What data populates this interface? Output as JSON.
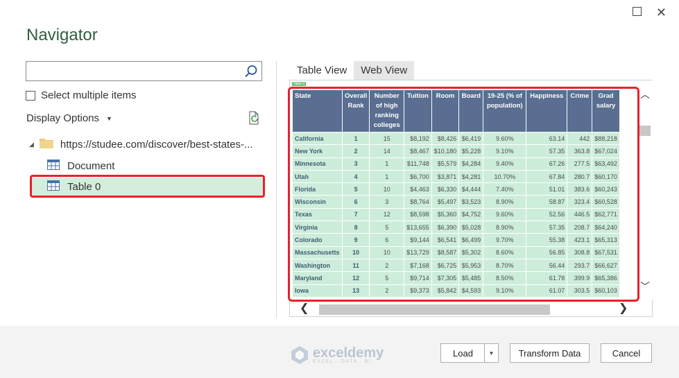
{
  "window": {
    "title": "Navigator"
  },
  "search": {
    "value": "",
    "placeholder": ""
  },
  "select_multiple_label": "Select multiple items",
  "display_options_label": "Display Options",
  "tree": {
    "root_label": "https://studee.com/discover/best-states-...",
    "items": [
      {
        "label": "Document",
        "icon": "table-icon",
        "selected": false
      },
      {
        "label": "Table 0",
        "icon": "table-icon",
        "selected": true
      }
    ]
  },
  "tabs": [
    {
      "label": "Table View",
      "active": true
    },
    {
      "label": "Web View",
      "active": false
    }
  ],
  "preview": {
    "tag": "Table 0",
    "headers": [
      "State",
      "Overall Rank",
      "Number of high ranking colleges",
      "Tuition",
      "Room",
      "Board",
      "19-25 (% of population)",
      "Happiness",
      "Crime",
      "Grad salary"
    ],
    "rows": [
      [
        "California",
        "1",
        "15",
        "$8,192",
        "$8,426",
        "$6,419",
        "9.60%",
        "63.14",
        "442",
        "$88,218"
      ],
      [
        "New York",
        "2",
        "14",
        "$8,467",
        "$10,180",
        "$5,228",
        "9.10%",
        "57.35",
        "363.8",
        "$67,024"
      ],
      [
        "Minnesota",
        "3",
        "1",
        "$11,748",
        "$5,579",
        "$4,284",
        "9.40%",
        "67.26",
        "277.5",
        "$63,492"
      ],
      [
        "Utah",
        "4",
        "1",
        "$6,700",
        "$3,871",
        "$4,281",
        "10.70%",
        "67.84",
        "280.7",
        "$60,170"
      ],
      [
        "Florida",
        "5",
        "10",
        "$4,463",
        "$6,330",
        "$4,444",
        "7.40%",
        "51.01",
        "383.6",
        "$60,243"
      ],
      [
        "Wisconsin",
        "6",
        "3",
        "$8,764",
        "$5,497",
        "$3,523",
        "8.90%",
        "58.87",
        "323.4",
        "$60,528"
      ],
      [
        "Texas",
        "7",
        "12",
        "$8,598",
        "$5,360",
        "$4,752",
        "9.60%",
        "52.56",
        "446.5",
        "$62,771"
      ],
      [
        "Virginia",
        "8",
        "5",
        "$13,655",
        "$6,390",
        "$5,028",
        "8.90%",
        "57.35",
        "208.7",
        "$64,240"
      ],
      [
        "Colorado",
        "9",
        "6",
        "$9,144",
        "$6,541",
        "$6,499",
        "9.70%",
        "55.38",
        "423.1",
        "$65,313"
      ],
      [
        "Massachusetts",
        "10",
        "10",
        "$13,729",
        "$8,587",
        "$5,302",
        "8.60%",
        "56.85",
        "308.8",
        "$67,531"
      ],
      [
        "Washington",
        "11",
        "2",
        "$7,168",
        "$6,725",
        "$5,953",
        "8.70%",
        "56.44",
        "293.7",
        "$66,627"
      ],
      [
        "Maryland",
        "12",
        "5",
        "$9,714",
        "$7,305",
        "$5,485",
        "8.50%",
        "61.78",
        "399.9",
        "$65,386"
      ],
      [
        "Iowa",
        "13",
        "2",
        "$9,373",
        "$5,842",
        "$4,593",
        "9.10%",
        "61.07",
        "303.5",
        "$60,103"
      ]
    ]
  },
  "logo": {
    "name": "exceldemy",
    "tagline": "EXCEL · DATA · BI"
  },
  "buttons": {
    "load": "Load",
    "transform": "Transform Data",
    "cancel": "Cancel"
  },
  "colors": {
    "accent": "#2f5f3f",
    "highlight": "#e8202a",
    "selected_bg": "#d6ecdc",
    "header_bg": "#596e91",
    "cell_bg": "#cdeddb"
  }
}
